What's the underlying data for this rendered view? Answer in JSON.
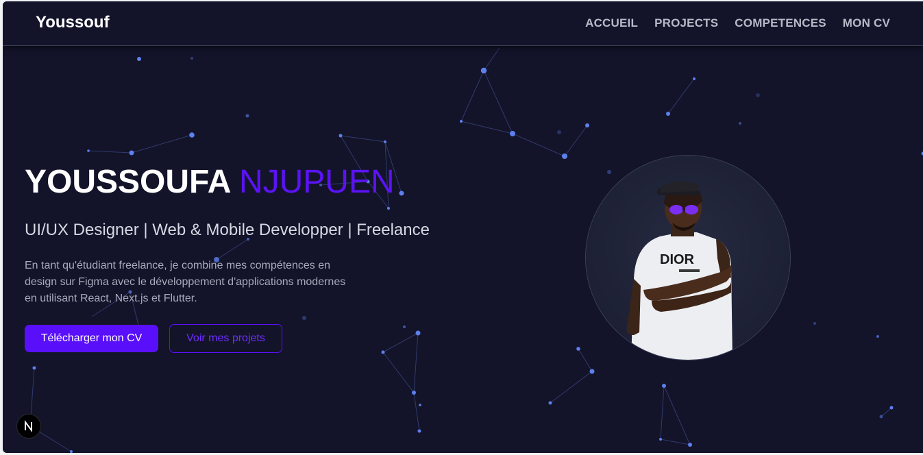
{
  "navbar": {
    "brand": "Youssouf",
    "links": [
      {
        "label": "ACCUEIL"
      },
      {
        "label": "PROJECTS"
      },
      {
        "label": "COMPETENCES"
      },
      {
        "label": "MON CV"
      }
    ]
  },
  "hero": {
    "first_name": "YOUSSOUFA",
    "last_name": "NJUPUEN",
    "subtitle": "UI/UX Designer | Web & Mobile Developper | Freelance",
    "description": "En tant qu'étudiant freelance, je combine mes compétences en design sur Figma avec le développement d'applications modernes en utilisant React, Next.js et Flutter.",
    "primary_button": "Télécharger mon CV",
    "secondary_button": "Voir mes projets"
  },
  "profile_photo": {
    "icon": "profile-photo"
  },
  "dev_badge": {
    "icon": "nextjs-logo-icon"
  },
  "colors": {
    "background": "#13142a",
    "accent": "#5a0ffa",
    "particle": "#5b7fe8",
    "text_primary": "#ffffff",
    "text_secondary": "#a8abbb"
  }
}
